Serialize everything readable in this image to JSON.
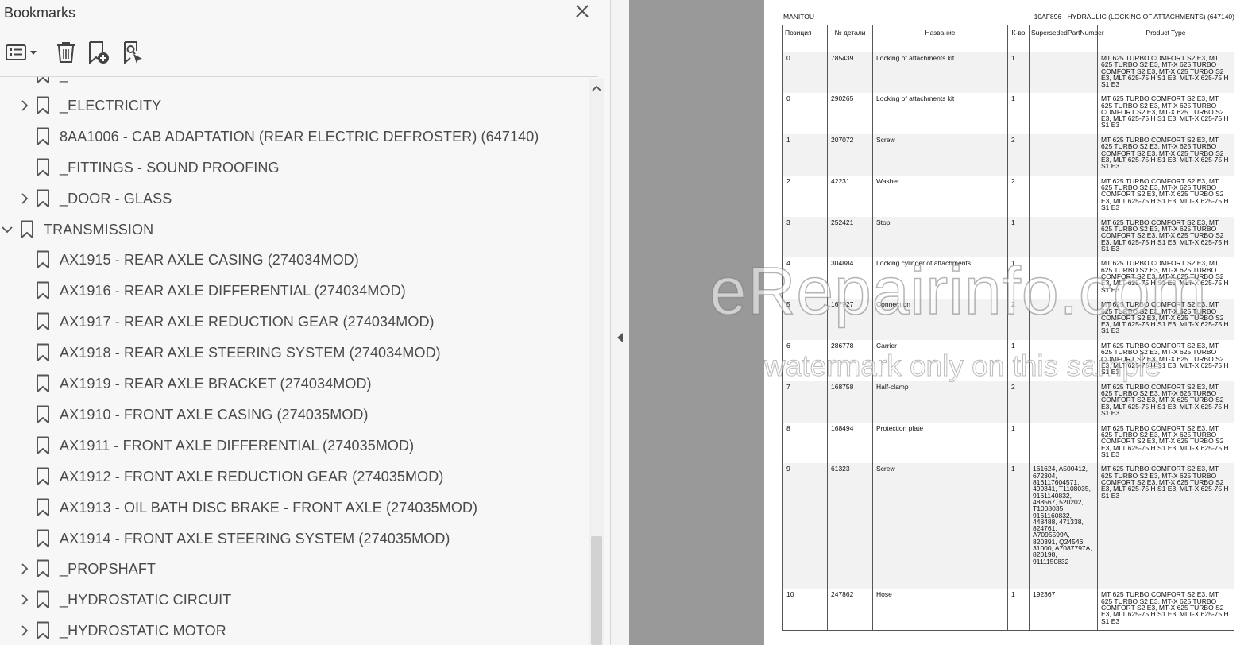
{
  "bookmarks_panel": {
    "title": "Bookmarks",
    "items": [
      {
        "label": "_",
        "level": 1,
        "toggle": "none"
      },
      {
        "label": "_ELECTRICITY",
        "level": 1,
        "toggle": "collapsed"
      },
      {
        "label": "8AA1006 - CAB ADAPTATION (REAR ELECTRIC DEFROSTER) (647140)",
        "level": 1,
        "toggle": "none"
      },
      {
        "label": "_FITTINGS - SOUND PROOFING",
        "level": 1,
        "toggle": "none"
      },
      {
        "label": "_DOOR - GLASS",
        "level": 1,
        "toggle": "collapsed"
      },
      {
        "label": "TRANSMISSION",
        "level": 0,
        "toggle": "expanded"
      },
      {
        "label": "AX1915 - REAR AXLE CASING (274034MOD)",
        "level": 1,
        "toggle": "none"
      },
      {
        "label": "AX1916 - REAR AXLE DIFFERENTIAL (274034MOD)",
        "level": 1,
        "toggle": "none"
      },
      {
        "label": "AX1917 - REAR AXLE REDUCTION GEAR (274034MOD)",
        "level": 1,
        "toggle": "none"
      },
      {
        "label": "AX1918 - REAR AXLE STEERING SYSTEM (274034MOD)",
        "level": 1,
        "toggle": "none"
      },
      {
        "label": "AX1919 - REAR AXLE BRACKET (274034MOD)",
        "level": 1,
        "toggle": "none"
      },
      {
        "label": "AX1910 - FRONT AXLE CASING (274035MOD)",
        "level": 1,
        "toggle": "none"
      },
      {
        "label": "AX1911 - FRONT AXLE DIFFERENTIAL (274035MOD)",
        "level": 1,
        "toggle": "none"
      },
      {
        "label": "AX1912 - FRONT AXLE REDUCTION GEAR (274035MOD)",
        "level": 1,
        "toggle": "none"
      },
      {
        "label": "AX1913 - OIL BATH DISC BRAKE - FRONT AXLE (274035MOD)",
        "level": 1,
        "toggle": "none"
      },
      {
        "label": "AX1914 - FRONT AXLE STEERING SYSTEM (274035MOD)",
        "level": 1,
        "toggle": "none"
      },
      {
        "label": "_PROPSHAFT",
        "level": 1,
        "toggle": "collapsed"
      },
      {
        "label": "_HYDROSTATIC CIRCUIT",
        "level": 1,
        "toggle": "collapsed"
      },
      {
        "label": "_HYDROSTATIC MOTOR",
        "level": 1,
        "toggle": "collapsed"
      }
    ]
  },
  "document": {
    "brand": "MANITOU",
    "title": "10AF896 - HYDRAULIC (LOCKING OF ATTACHMENTS) (647140)",
    "columns": [
      "Позиция",
      "№ детали",
      "Название",
      "К-во",
      "SupersededPartNumber",
      "Product Type"
    ],
    "rows": [
      {
        "pos": "0",
        "part": "785439",
        "name": "Locking of attachments kit",
        "qty": "1",
        "superseded": "",
        "product": "MT 625 TURBO COMFORT S2 E3, MT 625 TURBO S2 E3, MT-X 625 TURBO COMFORT S2 E3, MT-X 625 TURBO S2 E3, MLT 625-75 H S1 E3, MLT-X 625-75 H S1 E3"
      },
      {
        "pos": "0",
        "part": "290265",
        "name": "Locking of attachments kit",
        "qty": "1",
        "superseded": "",
        "product": "MT 625 TURBO COMFORT S2 E3, MT 625 TURBO S2 E3, MT-X 625 TURBO COMFORT S2 E3, MT-X 625 TURBO S2 E3, MLT 625-75 H S1 E3, MLT-X 625-75 H S1 E3"
      },
      {
        "pos": "1",
        "part": "207072",
        "name": "Screw",
        "qty": "2",
        "superseded": "",
        "product": "MT 625 TURBO COMFORT S2 E3, MT 625 TURBO S2 E3, MT-X 625 TURBO COMFORT S2 E3, MT-X 625 TURBO S2 E3, MLT 625-75 H S1 E3, MLT-X 625-75 H S1 E3"
      },
      {
        "pos": "2",
        "part": "42231",
        "name": "Washer",
        "qty": "2",
        "superseded": "",
        "product": "MT 625 TURBO COMFORT S2 E3, MT 625 TURBO S2 E3, MT-X 625 TURBO COMFORT S2 E3, MT-X 625 TURBO S2 E3, MLT 625-75 H S1 E3, MLT-X 625-75 H S1 E3"
      },
      {
        "pos": "3",
        "part": "252421",
        "name": "Stop",
        "qty": "1",
        "superseded": "",
        "product": "MT 625 TURBO COMFORT S2 E3, MT 625 TURBO S2 E3, MT-X 625 TURBO COMFORT S2 E3, MT-X 625 TURBO S2 E3, MLT 625-75 H S1 E3, MLT-X 625-75 H S1 E3"
      },
      {
        "pos": "4",
        "part": "304884",
        "name": "Locking cylinder of attachments",
        "qty": "1",
        "superseded": "",
        "product": "MT 625 TURBO COMFORT S2 E3, MT 625 TURBO S2 E3, MT-X 625 TURBO COMFORT S2 E3, MT-X 625 TURBO S2 E3, MLT 625-75 H S1 E3, MLT-X 625-75 H S1 E3"
      },
      {
        "pos": "5",
        "part": "167927",
        "name": "Connection",
        "qty": "2",
        "superseded": "",
        "product": "MT 625 TURBO COMFORT S2 E3, MT 625 TURBO S2 E3, MT-X 625 TURBO COMFORT S2 E3, MT-X 625 TURBO S2 E3, MLT 625-75 H S1 E3, MLT-X 625-75 H S1 E3"
      },
      {
        "pos": "6",
        "part": "286778",
        "name": "Carrier",
        "qty": "1",
        "superseded": "",
        "product": "MT 625 TURBO COMFORT S2 E3, MT 625 TURBO S2 E3, MT-X 625 TURBO COMFORT S2 E3, MT-X 625 TURBO S2 E3, MLT 625-75 H S1 E3, MLT-X 625-75 H S1 E3"
      },
      {
        "pos": "7",
        "part": "168758",
        "name": "Half-clamp",
        "qty": "2",
        "superseded": "",
        "product": "MT 625 TURBO COMFORT S2 E3, MT 625 TURBO S2 E3, MT-X 625 TURBO COMFORT S2 E3, MT-X 625 TURBO S2 E3, MLT 625-75 H S1 E3, MLT-X 625-75 H S1 E3"
      },
      {
        "pos": "8",
        "part": "168494",
        "name": "Protection plate",
        "qty": "1",
        "superseded": "",
        "product": "MT 625 TURBO COMFORT S2 E3, MT 625 TURBO S2 E3, MT-X 625 TURBO COMFORT S2 E3, MT-X 625 TURBO S2 E3, MLT 625-75 H S1 E3, MLT-X 625-75 H S1 E3"
      },
      {
        "pos": "9",
        "part": "61323",
        "name": "Screw",
        "qty": "1",
        "superseded": "161624, A500412, 672304, 816117604571, 499341, T1108035, 9161140832, 488567, 520202, T1008035, 9161160832, 448488, 471338, 824761, A7095599A, 820391, Q24546, 31000, A7087797A, 820198, 9111150832",
        "product": "MT 625 TURBO COMFORT S2 E3, MT 625 TURBO S2 E3, MT-X 625 TURBO COMFORT S2 E3, MT-X 625 TURBO S2 E3, MLT 625-75 H S1 E3, MLT-X 625-75 H S1 E3"
      },
      {
        "pos": "10",
        "part": "247862",
        "name": "Hose",
        "qty": "1",
        "superseded": "192367",
        "product": "MT 625 TURBO COMFORT S2 E3, MT 625 TURBO S2 E3, MT-X 625 TURBO COMFORT S2 E3, MT-X 625 TURBO S2 E3, MLT 625-75 H S1 E3, MLT-X 625-75 H S1 E3"
      }
    ]
  },
  "watermark": {
    "line1": "eRepairinfo.com",
    "line2": "watermark only on this sample"
  },
  "icons": {
    "close": "close-icon",
    "options": "options-menu-icon",
    "delete": "trash-icon",
    "new_bookmark": "new-bookmark-icon",
    "find_bookmark": "find-current-bookmark-icon",
    "bookmark": "bookmark-icon",
    "collapse_panel": "triangle-left-icon"
  },
  "colors": {
    "panel_bg": "#f7f7f7",
    "doc_bg": "#999999",
    "row_shade": "#f2f2f2",
    "text": "#4a4a4a"
  }
}
